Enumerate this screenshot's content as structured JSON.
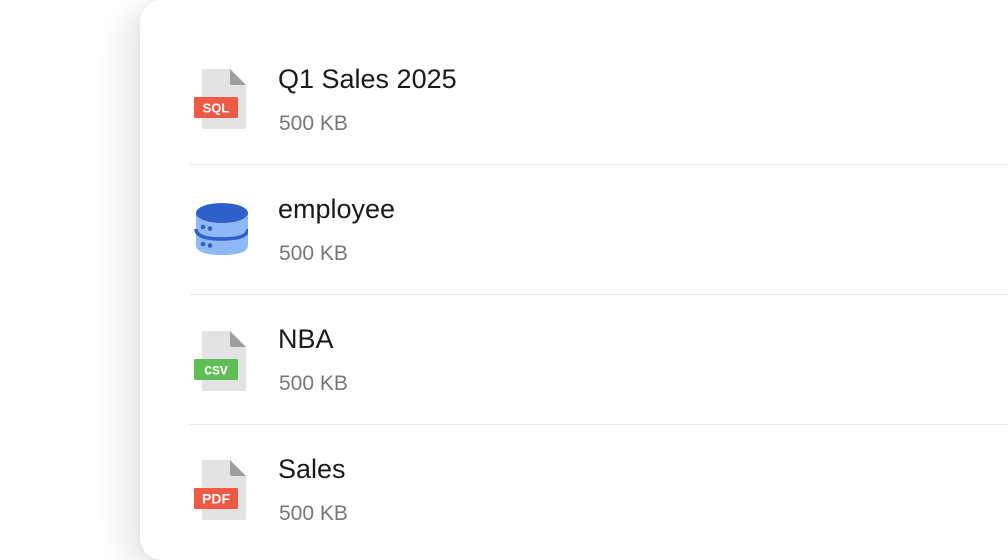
{
  "files": [
    {
      "name": "Q1 Sales 2025",
      "size": "500 KB",
      "icon": "sql-file-icon",
      "badge": "SQL",
      "badge_color": "#ef5a45"
    },
    {
      "name": "employee",
      "size": "500 KB",
      "icon": "database-icon",
      "badge": "",
      "badge_color": "#2f5fc9"
    },
    {
      "name": "NBA",
      "size": "500 KB",
      "icon": "csv-file-icon",
      "badge": "CSV",
      "badge_color": "#5fbf55"
    },
    {
      "name": "Sales",
      "size": "500 KB",
      "icon": "pdf-file-icon",
      "badge": "PDF",
      "badge_color": "#ef5a45"
    }
  ]
}
